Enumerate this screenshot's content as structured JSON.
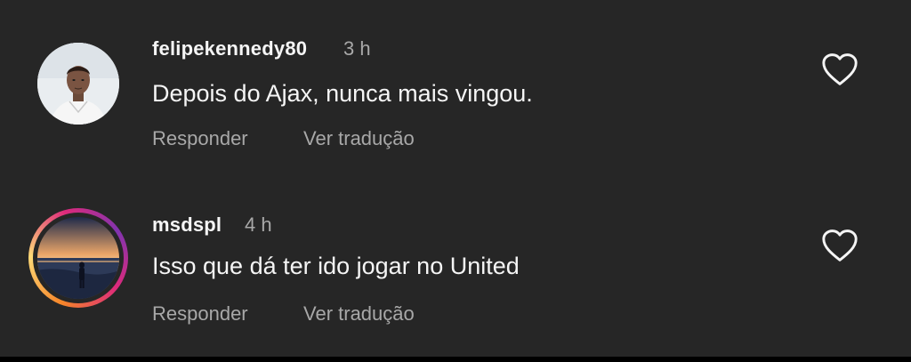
{
  "comments": [
    {
      "username": "felipekennedy80",
      "time": "3 h",
      "text": "Depois do Ajax, nunca mais vingou.",
      "reply_label": "Responder",
      "translate_label": "Ver tradução",
      "avatar_icon": "profile-photo",
      "has_story_ring": false
    },
    {
      "username": "msdspl",
      "time": "4 h",
      "text": "Isso que dá ter ido jogar no United",
      "reply_label": "Responder",
      "translate_label": "Ver tradução",
      "avatar_icon": "profile-photo",
      "has_story_ring": true
    }
  ],
  "icons": {
    "like": "heart-outline-icon"
  },
  "colors": {
    "background": "#262626",
    "primary_text": "#f5f5f5",
    "secondary_text": "#a8a8a8",
    "story_ring": [
      "#f58529",
      "#feda77",
      "#dd2a7b",
      "#8134af"
    ]
  }
}
